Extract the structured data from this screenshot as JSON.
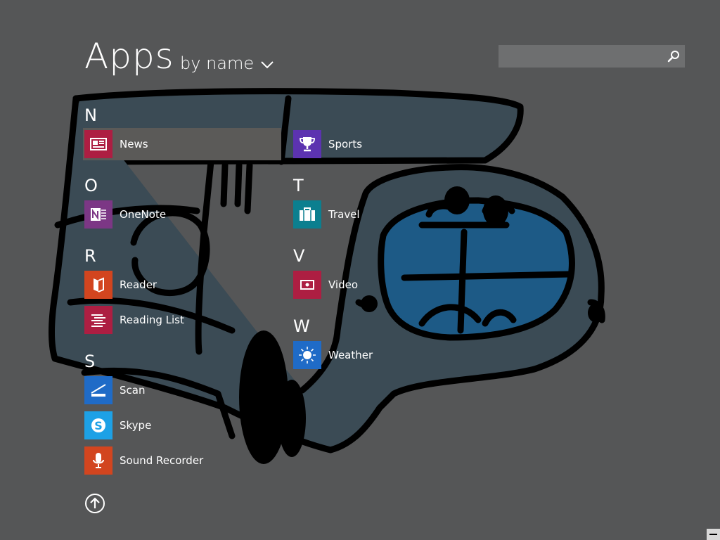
{
  "header": {
    "title": "Apps",
    "sort_label": "by name"
  },
  "search": {
    "value": "",
    "placeholder": ""
  },
  "colors": {
    "background": "#555657",
    "news": "#ad1e42",
    "onenote": "#7c3785",
    "reader": "#d2451f",
    "reading_list": "#ad1e42",
    "scan": "#1f6bc7",
    "skype": "#1da1e6",
    "sound_recorder": "#d2451f",
    "sports": "#5c33b0",
    "travel": "#0b7f8f",
    "video": "#ad1e42",
    "weather": "#1f6bc7"
  },
  "groups": [
    {
      "letter": "N",
      "apps": [
        {
          "label": "News",
          "icon": "news-icon"
        }
      ]
    },
    {
      "letter": "O",
      "apps": [
        {
          "label": "OneNote",
          "icon": "onenote-icon"
        }
      ]
    },
    {
      "letter": "R",
      "apps": [
        {
          "label": "Reader",
          "icon": "reader-icon"
        },
        {
          "label": "Reading List",
          "icon": "reading-list-icon"
        }
      ]
    },
    {
      "letter": "S",
      "apps": [
        {
          "label": "Scan",
          "icon": "scan-icon"
        },
        {
          "label": "Skype",
          "icon": "skype-icon"
        },
        {
          "label": "Sound Recorder",
          "icon": "microphone-icon"
        }
      ]
    },
    {
      "letter": "",
      "apps": [
        {
          "label": "Sports",
          "icon": "trophy-icon"
        }
      ]
    },
    {
      "letter": "T",
      "apps": [
        {
          "label": "Travel",
          "icon": "suitcase-icon"
        }
      ]
    },
    {
      "letter": "V",
      "apps": [
        {
          "label": "Video",
          "icon": "video-icon"
        }
      ]
    },
    {
      "letter": "W",
      "apps": [
        {
          "label": "Weather",
          "icon": "sun-icon"
        }
      ]
    }
  ],
  "footer": {
    "scroll_up_icon": "arrow-up-circle-icon"
  }
}
